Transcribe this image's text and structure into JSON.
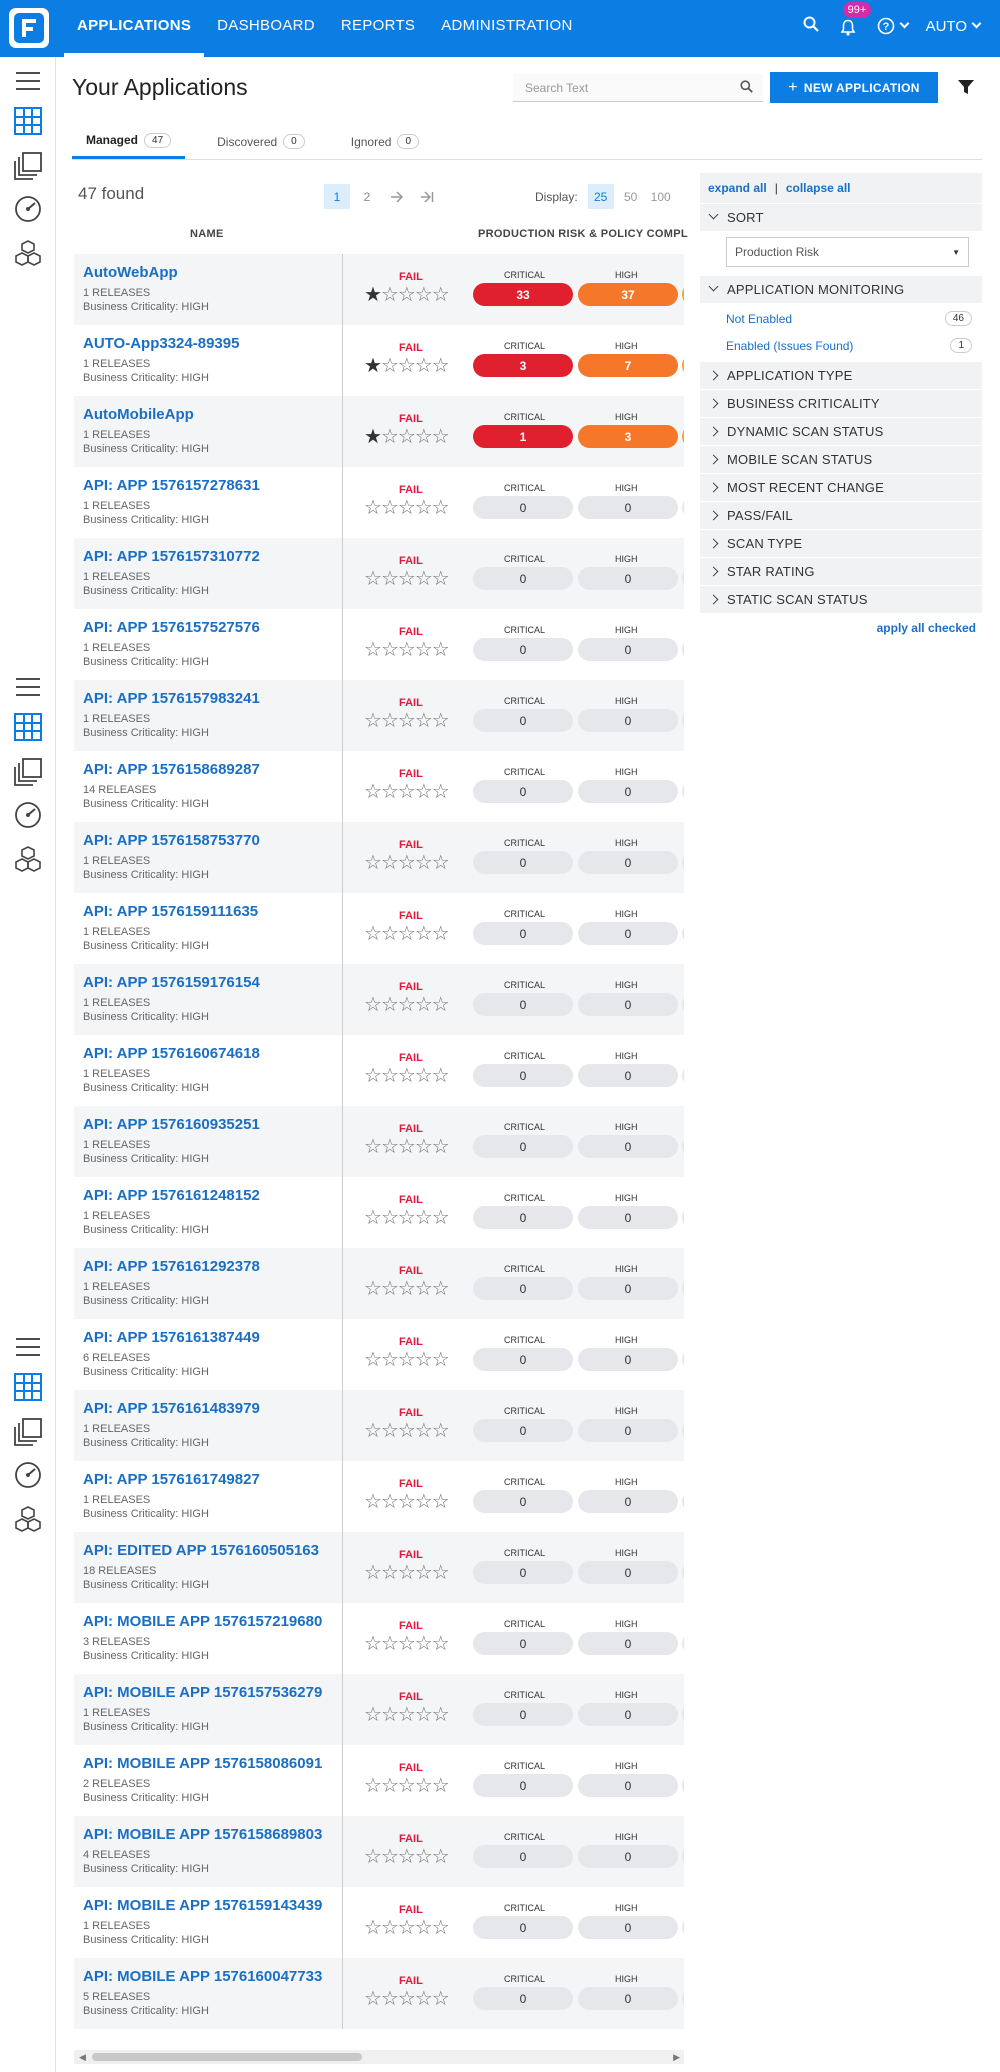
{
  "nav": {
    "items": [
      "APPLICATIONS",
      "DASHBOARD",
      "REPORTS",
      "ADMINISTRATION"
    ],
    "notif_count": "99+",
    "user": "AUTO"
  },
  "page": {
    "title": "Your Applications",
    "search_placeholder": "Search Text",
    "new_app_label": "NEW APPLICATION"
  },
  "tabs": [
    {
      "label": "Managed",
      "count": "47"
    },
    {
      "label": "Discovered",
      "count": "0"
    },
    {
      "label": "Ignored",
      "count": "0"
    }
  ],
  "results": {
    "found": "47 found",
    "pages": [
      "1",
      "2"
    ],
    "display_label": "Display:",
    "display_opts": [
      "25",
      "50",
      "100"
    ]
  },
  "columns": {
    "name": "NAME",
    "risk": "PRODUCTION RISK & POLICY COMPLIANCE"
  },
  "labels": {
    "critical": "CRITICAL",
    "high": "HIGH",
    "fail": "FAIL"
  },
  "apps": [
    {
      "name": "AutoWebApp",
      "releases": "1 RELEASES",
      "criticality": "Business Criticality: HIGH",
      "stars": 1,
      "critical": "33",
      "high": "37"
    },
    {
      "name": "AUTO-App3324-89395",
      "releases": "1 RELEASES",
      "criticality": "Business Criticality: HIGH",
      "stars": 1,
      "critical": "3",
      "high": "7"
    },
    {
      "name": "AutoMobileApp",
      "releases": "1 RELEASES",
      "criticality": "Business Criticality: HIGH",
      "stars": 1,
      "critical": "1",
      "high": "3"
    },
    {
      "name": "API: APP 1576157278631",
      "releases": "1 RELEASES",
      "criticality": "Business Criticality: HIGH",
      "stars": 0,
      "critical": "0",
      "high": "0"
    },
    {
      "name": "API: APP 1576157310772",
      "releases": "1 RELEASES",
      "criticality": "Business Criticality: HIGH",
      "stars": 0,
      "critical": "0",
      "high": "0"
    },
    {
      "name": "API: APP 1576157527576",
      "releases": "1 RELEASES",
      "criticality": "Business Criticality: HIGH",
      "stars": 0,
      "critical": "0",
      "high": "0"
    },
    {
      "name": "API: APP 1576157983241",
      "releases": "1 RELEASES",
      "criticality": "Business Criticality: HIGH",
      "stars": 0,
      "critical": "0",
      "high": "0"
    },
    {
      "name": "API: APP 1576158689287",
      "releases": "14 RELEASES",
      "criticality": "Business Criticality: HIGH",
      "stars": 0,
      "critical": "0",
      "high": "0"
    },
    {
      "name": "API: APP 1576158753770",
      "releases": "1 RELEASES",
      "criticality": "Business Criticality: HIGH",
      "stars": 0,
      "critical": "0",
      "high": "0"
    },
    {
      "name": "API: APP 1576159111635",
      "releases": "1 RELEASES",
      "criticality": "Business Criticality: HIGH",
      "stars": 0,
      "critical": "0",
      "high": "0"
    },
    {
      "name": "API: APP 1576159176154",
      "releases": "1 RELEASES",
      "criticality": "Business Criticality: HIGH",
      "stars": 0,
      "critical": "0",
      "high": "0"
    },
    {
      "name": "API: APP 1576160674618",
      "releases": "1 RELEASES",
      "criticality": "Business Criticality: HIGH",
      "stars": 0,
      "critical": "0",
      "high": "0"
    },
    {
      "name": "API: APP 1576160935251",
      "releases": "1 RELEASES",
      "criticality": "Business Criticality: HIGH",
      "stars": 0,
      "critical": "0",
      "high": "0"
    },
    {
      "name": "API: APP 1576161248152",
      "releases": "1 RELEASES",
      "criticality": "Business Criticality: HIGH",
      "stars": 0,
      "critical": "0",
      "high": "0"
    },
    {
      "name": "API: APP 1576161292378",
      "releases": "1 RELEASES",
      "criticality": "Business Criticality: HIGH",
      "stars": 0,
      "critical": "0",
      "high": "0"
    },
    {
      "name": "API: APP 1576161387449",
      "releases": "6 RELEASES",
      "criticality": "Business Criticality: HIGH",
      "stars": 0,
      "critical": "0",
      "high": "0"
    },
    {
      "name": "API: APP 1576161483979",
      "releases": "1 RELEASES",
      "criticality": "Business Criticality: HIGH",
      "stars": 0,
      "critical": "0",
      "high": "0"
    },
    {
      "name": "API: APP 1576161749827",
      "releases": "1 RELEASES",
      "criticality": "Business Criticality: HIGH",
      "stars": 0,
      "critical": "0",
      "high": "0"
    },
    {
      "name": "API: EDITED APP 1576160505163",
      "releases": "18 RELEASES",
      "criticality": "Business Criticality: HIGH",
      "stars": 0,
      "critical": "0",
      "high": "0"
    },
    {
      "name": "API: MOBILE APP 1576157219680",
      "releases": "3 RELEASES",
      "criticality": "Business Criticality: HIGH",
      "stars": 0,
      "critical": "0",
      "high": "0"
    },
    {
      "name": "API: MOBILE APP 1576157536279",
      "releases": "1 RELEASES",
      "criticality": "Business Criticality: HIGH",
      "stars": 0,
      "critical": "0",
      "high": "0"
    },
    {
      "name": "API: MOBILE APP 1576158086091",
      "releases": "2 RELEASES",
      "criticality": "Business Criticality: HIGH",
      "stars": 0,
      "critical": "0",
      "high": "0"
    },
    {
      "name": "API: MOBILE APP 1576158689803",
      "releases": "4 RELEASES",
      "criticality": "Business Criticality: HIGH",
      "stars": 0,
      "critical": "0",
      "high": "0"
    },
    {
      "name": "API: MOBILE APP 1576159143439",
      "releases": "1 RELEASES",
      "criticality": "Business Criticality: HIGH",
      "stars": 0,
      "critical": "0",
      "high": "0"
    },
    {
      "name": "API: MOBILE APP 1576160047733",
      "releases": "5 RELEASES",
      "criticality": "Business Criticality: HIGH",
      "stars": 0,
      "critical": "0",
      "high": "0"
    }
  ],
  "filters": {
    "expand_all": "expand all",
    "collapse_all": "collapse all",
    "sort_label": "SORT",
    "sort_value": "Production Risk",
    "monitoring_label": "APPLICATION MONITORING",
    "monitoring_items": [
      {
        "label": "Not Enabled",
        "count": "46"
      },
      {
        "label": "Enabled (Issues Found)",
        "count": "1"
      }
    ],
    "sections": [
      "APPLICATION TYPE",
      "BUSINESS CRITICALITY",
      "DYNAMIC SCAN STATUS",
      "MOBILE SCAN STATUS",
      "MOST RECENT CHANGE",
      "PASS/FAIL",
      "SCAN TYPE",
      "STAR RATING",
      "STATIC SCAN STATUS"
    ],
    "apply_label": "apply all checked"
  },
  "colors": {
    "brand": "#0b7de3",
    "critical": "#e0202e",
    "high": "#f4772a",
    "fail": "#e0183c"
  }
}
